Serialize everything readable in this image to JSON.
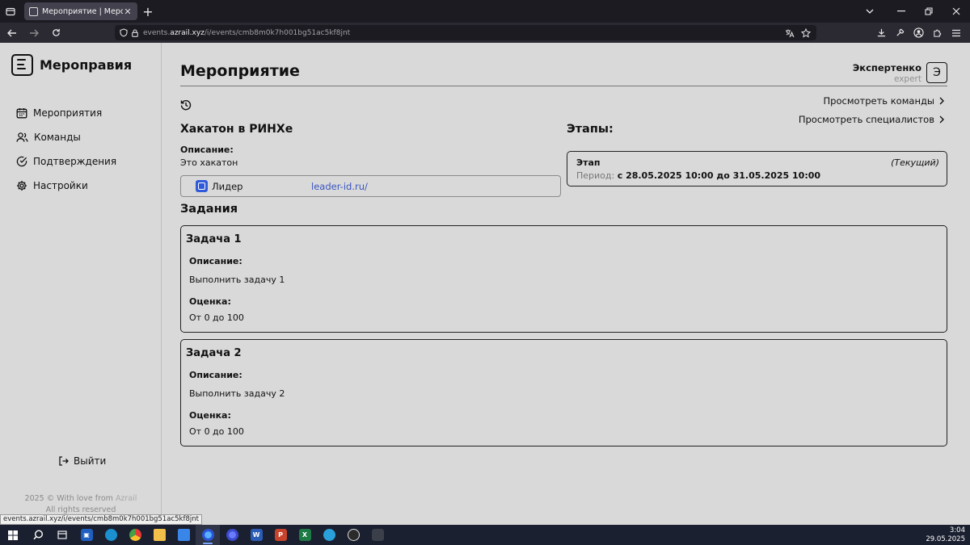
{
  "browser": {
    "tab_title": "Мероприятие | Мероправия",
    "url_host": "events.azrail.xyz",
    "url_prefix": "events.",
    "url_domain": "azrail.xyz",
    "url_path": "/i/events/cmb8m0k7h001bg51ac5kf8jnt",
    "status_url": "events.azrail.xyz/i/events/cmb8m0k7h001bg51ac5kf8jnt"
  },
  "sidebar": {
    "brand": "Мероправия",
    "items": [
      {
        "label": "Мероприятия",
        "icon": "calendar-icon"
      },
      {
        "label": "Команды",
        "icon": "users-icon"
      },
      {
        "label": "Подтверждения",
        "icon": "check-circle-icon"
      },
      {
        "label": "Настройки",
        "icon": "gear-icon"
      }
    ],
    "logout": "Выйти",
    "footer_line1": "2025 © With love from",
    "footer_author": "Azrail",
    "footer_line2": "All rights reserved"
  },
  "header": {
    "title": "Мероприятие",
    "user_name": "Экспертенко",
    "user_role": "expert",
    "avatar_letter": "Э",
    "link_teams": "Просмотреть команды",
    "link_specialists": "Просмотреть специалистов"
  },
  "event": {
    "name": "Хакатон в РИНХе",
    "desc_label": "Описание:",
    "desc": "Это хакатон",
    "link_name": "Лидер",
    "link_url": "leader-id.ru/"
  },
  "stages": {
    "title": "Этапы:",
    "items": [
      {
        "name": "Этап",
        "status": "(Текущий)",
        "period_label": "Период:",
        "period": "с 28.05.2025 10:00 до 31.05.2025 10:00"
      }
    ]
  },
  "tasks": {
    "title": "Задания",
    "items": [
      {
        "title": "Задача 1",
        "desc_label": "Описание:",
        "desc": "Выполнить задачу 1",
        "score_label": "Оценка:",
        "score": "От 0 до 100"
      },
      {
        "title": "Задача 2",
        "desc_label": "Описание:",
        "desc": "Выполнить задачу 2",
        "score_label": "Оценка:",
        "score": "От 0 до 100"
      }
    ]
  },
  "taskbar": {
    "time": "3:04",
    "date": "29.05.2025"
  },
  "colors": {
    "background": "#d9d9d9",
    "link": "#3a55c0",
    "id_badge": "#2f5bd8"
  }
}
